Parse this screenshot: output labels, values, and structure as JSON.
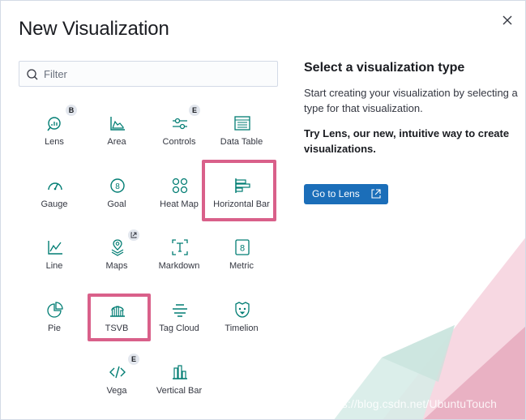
{
  "modal": {
    "title": "New Visualization",
    "close_icon": "close-icon"
  },
  "search": {
    "placeholder": "Filter",
    "value": "",
    "icon": "search-icon"
  },
  "types": [
    {
      "label": "Lens",
      "icon": "lens-icon",
      "badge": "B"
    },
    {
      "label": "Area",
      "icon": "area-chart-icon"
    },
    {
      "label": "Controls",
      "icon": "controls-icon",
      "badge": "E"
    },
    {
      "label": "Data Table",
      "icon": "data-table-icon"
    },
    {
      "label": "Gauge",
      "icon": "gauge-icon"
    },
    {
      "label": "Goal",
      "icon": "goal-icon"
    },
    {
      "label": "Heat Map",
      "icon": "heat-map-icon"
    },
    {
      "label": "Horizontal Bar",
      "icon": "horizontal-bar-icon",
      "highlighted": true
    },
    {
      "label": "Line",
      "icon": "line-chart-icon"
    },
    {
      "label": "Maps",
      "icon": "maps-icon",
      "external": true
    },
    {
      "label": "Markdown",
      "icon": "markdown-icon"
    },
    {
      "label": "Metric",
      "icon": "metric-icon"
    },
    {
      "label": "Pie",
      "icon": "pie-chart-icon"
    },
    {
      "label": "TSVB",
      "icon": "tsvb-icon",
      "highlighted": true
    },
    {
      "label": "Tag Cloud",
      "icon": "tag-cloud-icon"
    },
    {
      "label": "Timelion",
      "icon": "timelion-icon"
    },
    {
      "label": "Vega",
      "icon": "vega-icon",
      "badge": "E"
    },
    {
      "label": "Vertical Bar",
      "icon": "vertical-bar-icon"
    }
  ],
  "description": {
    "heading": "Select a visualization type",
    "text": "Start creating your visualization by selecting a type for that visualization.",
    "lens_promo": "Try Lens, our new, intuitive way to create visualizations.",
    "button_label": "Go to Lens",
    "button_icon": "external-link-icon"
  },
  "watermark": "https://blog.csdn.net/UbuntuTouch",
  "colors": {
    "accent": "#1b6eb9",
    "icon": "#017d73",
    "highlight": "#d9608a",
    "title": "#1a1c21"
  }
}
